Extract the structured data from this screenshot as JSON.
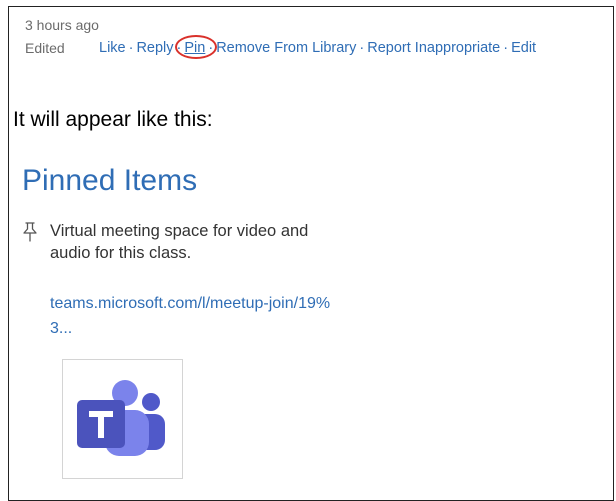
{
  "post_meta": {
    "time_ago": "3 hours ago",
    "edited_label": "Edited"
  },
  "actions": {
    "like": "Like",
    "reply": "Reply",
    "pin": "Pin",
    "remove_from_library": "Remove From Library",
    "report_inappropriate": "Report Inappropriate",
    "edit": "Edit",
    "separator": "·"
  },
  "instruction": "It will appear like this:",
  "pinned": {
    "title": "Pinned Items",
    "item_text": "Virtual meeting space for video and audio for this class.",
    "item_link": "teams.microsoft.com/l/meetup-join/19%3..."
  },
  "icons": {
    "pin": "pin-icon",
    "logo": "microsoft-teams-logo"
  },
  "colors": {
    "link": "#2f6db5",
    "highlight": "#d9312b",
    "teams_purple": "#5059c9",
    "teams_light": "#7b83eb",
    "meta_text": "#6b6b6b"
  }
}
